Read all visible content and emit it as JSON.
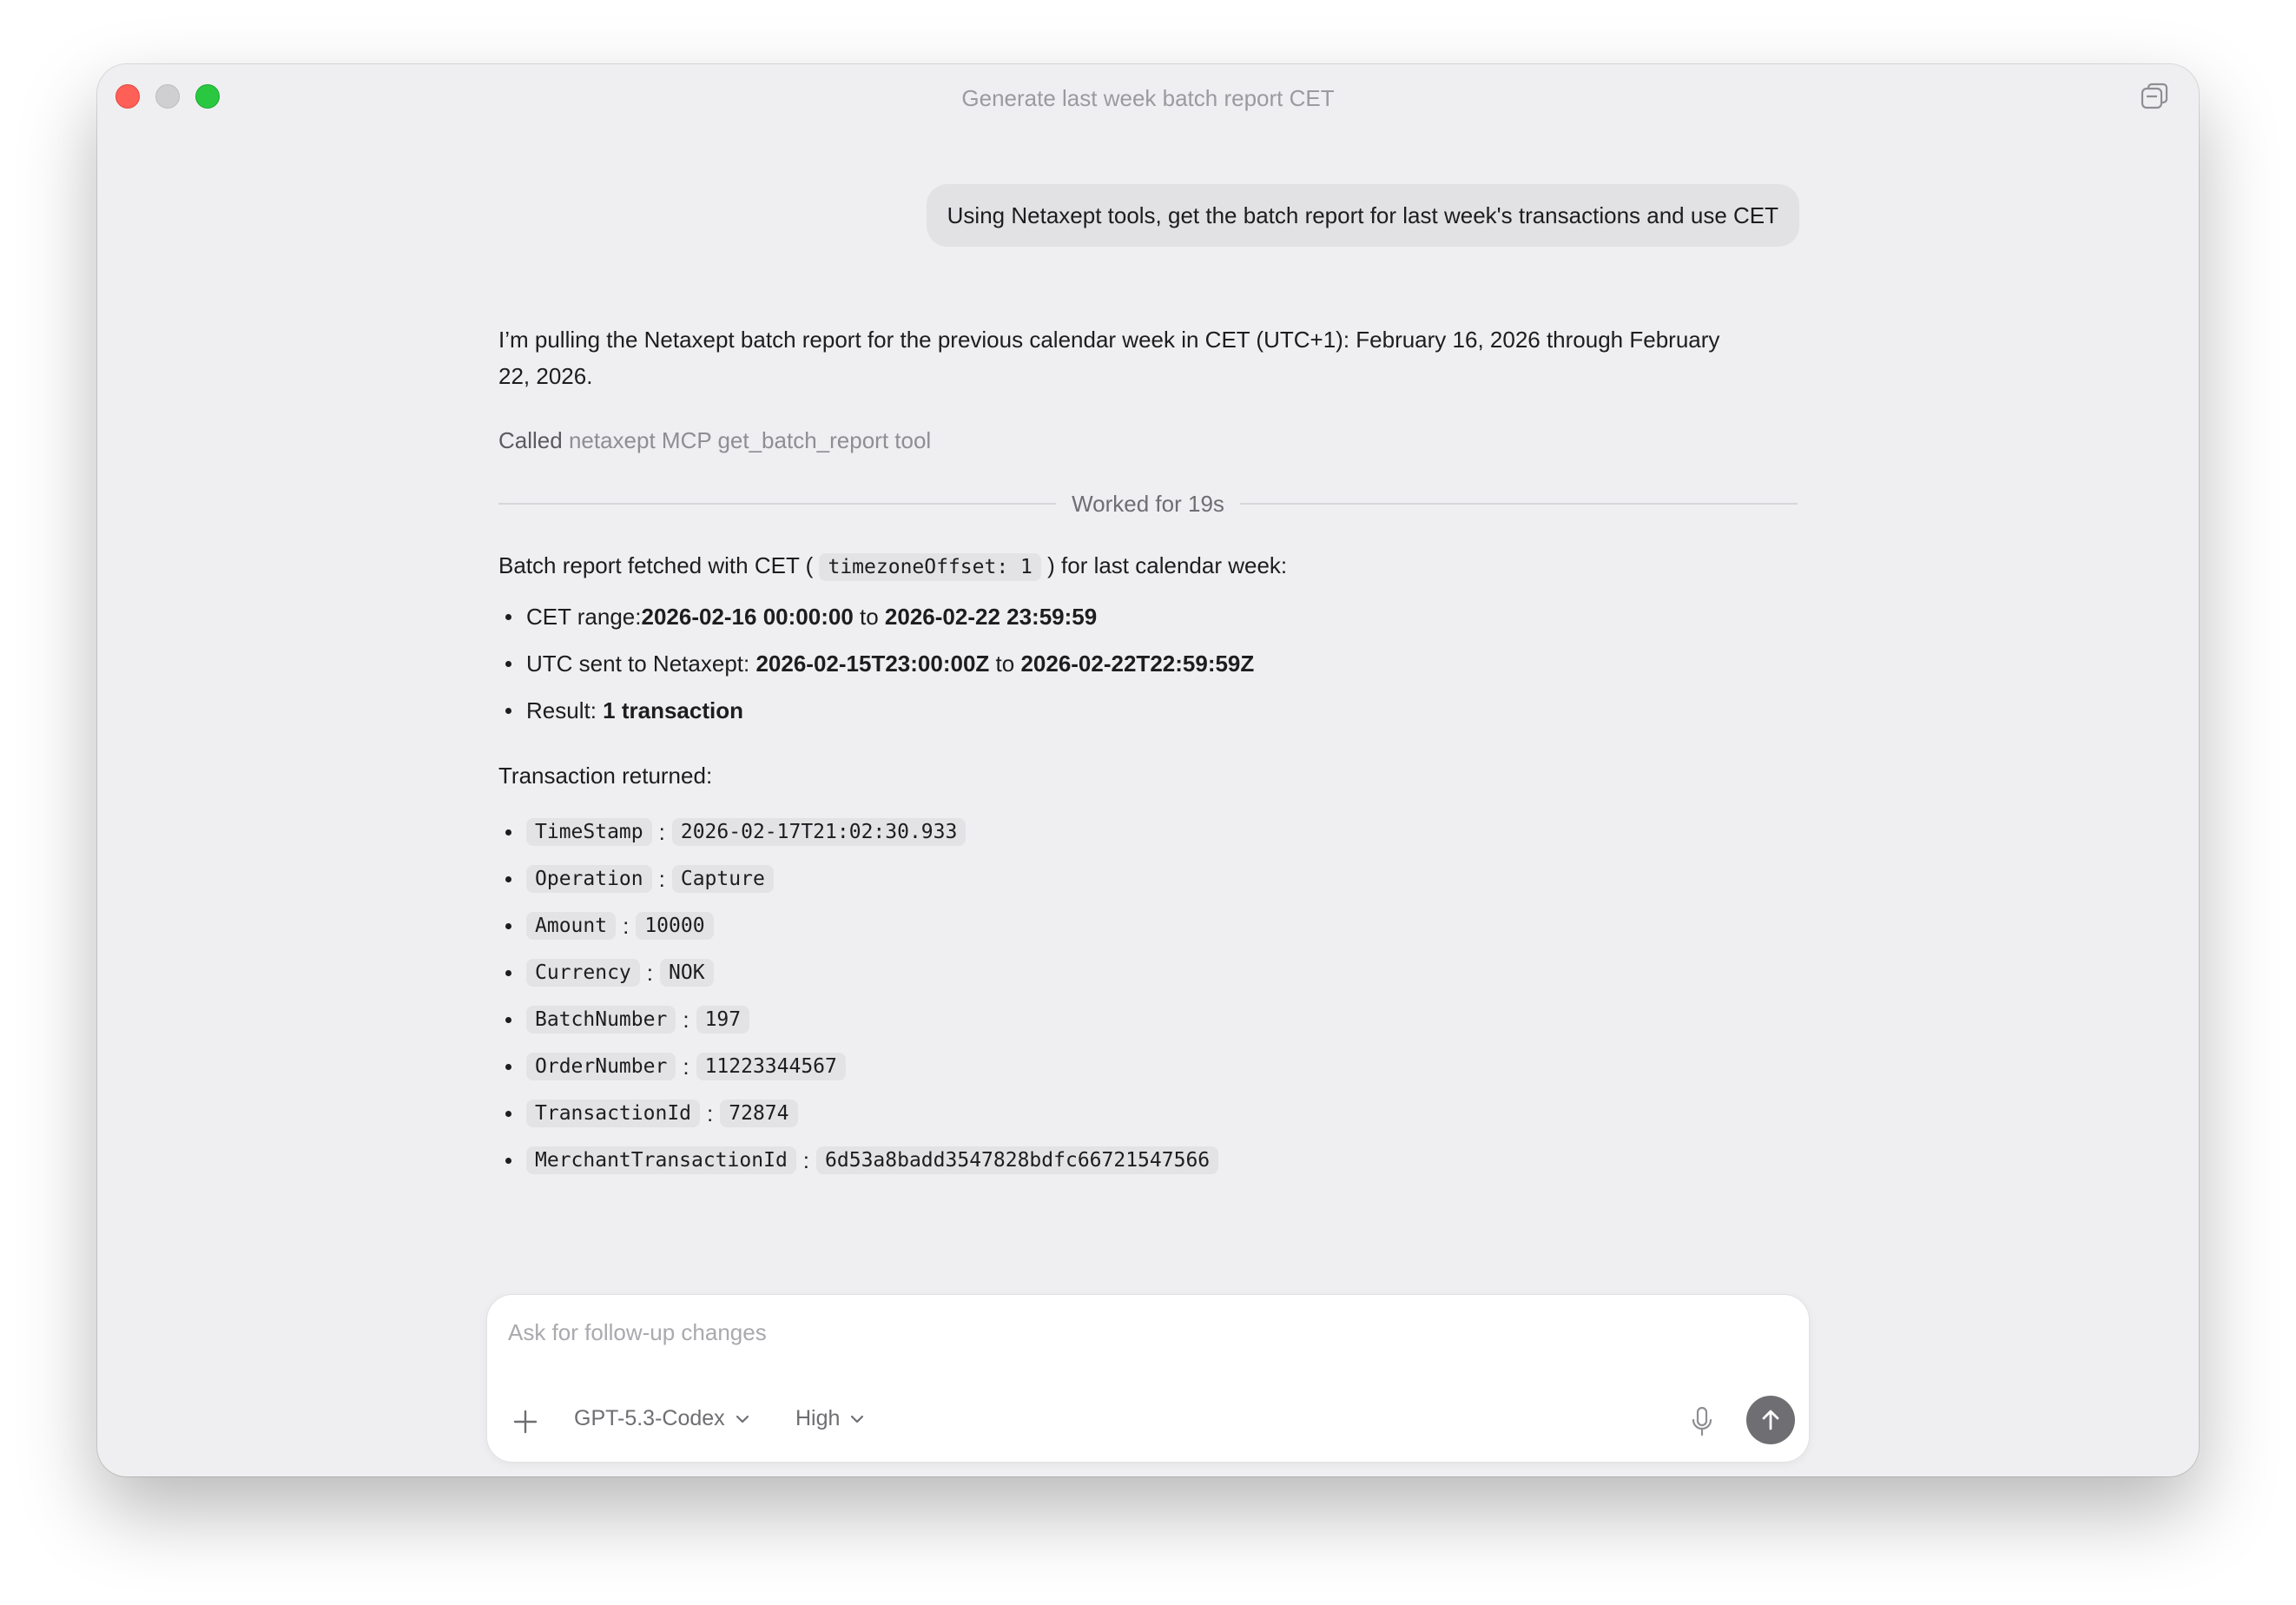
{
  "window": {
    "title": "Generate last week batch report CET"
  },
  "user_message": "Using Netaxept tools, get the batch report for last week's transactions and use CET",
  "assistant": {
    "intro_line1": "I’m pulling the Netaxept batch report for the previous calendar week in CET (UTC+1): February 16, 2026 through February",
    "intro_line2": "22, 2026.",
    "called_label": "Called",
    "called_tool": "netaxept MCP get_batch_report tool",
    "worked_for": "Worked for 19s",
    "fetched_prefix": "Batch report fetched with CET (",
    "fetched_code": "timezoneOffset: 1",
    "fetched_suffix": ") for last calendar week:",
    "summary": [
      {
        "label": "CET range: ",
        "from": "2026-02-16 00:00:00",
        "sep": " to ",
        "to": "2026-02-22 23:59:59"
      },
      {
        "label": "UTC sent to Netaxept: ",
        "from": "2026-02-15T23:00:00Z",
        "sep": " to ",
        "to": "2026-02-22T22:59:59Z"
      }
    ],
    "result_label": "Result: ",
    "result_value": "1 transaction",
    "transaction_heading": "Transaction returned:",
    "fields": [
      {
        "key": "TimeStamp",
        "value": "2026-02-17T21:02:30.933"
      },
      {
        "key": "Operation",
        "value": "Capture"
      },
      {
        "key": "Amount",
        "value": "10000"
      },
      {
        "key": "Currency",
        "value": "NOK"
      },
      {
        "key": "BatchNumber",
        "value": "197"
      },
      {
        "key": "OrderNumber",
        "value": "11223344567"
      },
      {
        "key": "TransactionId",
        "value": "72874"
      },
      {
        "key": "MerchantTransactionId",
        "value": "6d53a8badd3547828bdfc66721547566"
      }
    ],
    "colon": ":"
  },
  "composer": {
    "placeholder": "Ask for follow-up changes",
    "model": "GPT-5.3-Codex",
    "effort": "High"
  },
  "icons": {
    "titlebar": "new-window-icon",
    "add": "plus-icon",
    "chevron": "chevron-down-icon",
    "mic": "microphone-icon",
    "send": "arrow-up-icon"
  },
  "colors": {
    "window_bg": "#efeff1",
    "close": "#fe5f57",
    "max": "#29c840",
    "send_button": "#6e6e73"
  }
}
